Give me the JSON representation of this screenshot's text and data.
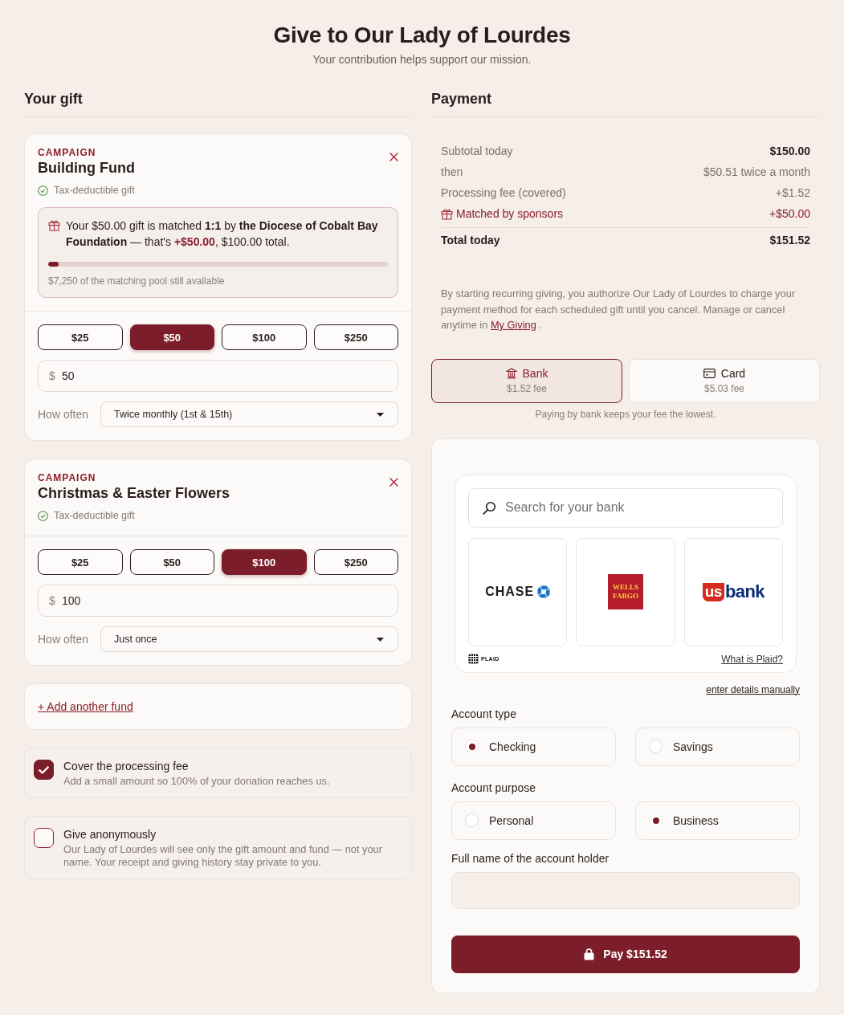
{
  "header": {
    "title": "Give to Our Lady of Lourdes",
    "subtitle": "Your contribution helps support our mission."
  },
  "gift": {
    "heading": "Your gift",
    "funds": [
      {
        "eyebrow": "CAMPAIGN",
        "name": "Building Fund",
        "tax_note": "Tax-deductible gift",
        "match": {
          "message": [
            {
              "text": "Your $50.00 gift is matched ",
              "kind": "plain"
            },
            {
              "text": "1:1",
              "kind": "bold"
            },
            {
              "text": " by ",
              "kind": "plain"
            },
            {
              "text": "the Diocese of Cobalt Bay Foundation",
              "kind": "bold"
            },
            {
              "text": " — that's ",
              "kind": "plain"
            },
            {
              "text": "+$50.00",
              "kind": "amount"
            },
            {
              "text": ", $100.00 total.",
              "kind": "plain"
            }
          ],
          "level": 0.03,
          "pool_note": "$7,250 of the matching pool still available"
        },
        "presets": [
          {
            "label": "$25",
            "selected": false
          },
          {
            "label": "$50",
            "selected": true
          },
          {
            "label": "$100",
            "selected": false
          },
          {
            "label": "$250",
            "selected": false
          }
        ],
        "amount": {
          "currency": "$",
          "value": "50"
        },
        "frequency": {
          "label": "How often",
          "value": "Twice monthly (1st & 15th)"
        }
      },
      {
        "eyebrow": "CAMPAIGN",
        "name": "Christmas & Easter Flowers",
        "tax_note": "Tax-deductible gift",
        "presets": [
          {
            "label": "$25",
            "selected": false
          },
          {
            "label": "$50",
            "selected": false
          },
          {
            "label": "$100",
            "selected": true
          },
          {
            "label": "$250",
            "selected": false
          }
        ],
        "amount": {
          "currency": "$",
          "value": "100"
        },
        "frequency": {
          "label": "How often",
          "value": "Just once"
        }
      }
    ],
    "add_fund_link": "+ Add another fund",
    "options": [
      {
        "title": "Cover the processing fee",
        "description": "Add a small amount so 100% of your donation reaches us.",
        "checked": true
      },
      {
        "title": "Give anonymously",
        "description": "Our Lady of Lourdes will see only the gift amount and fund — not your name. Your receipt and giving history stay private to you.",
        "checked": false
      }
    ]
  },
  "payment": {
    "heading": "Payment",
    "summary": [
      {
        "label": "Subtotal today",
        "value": "$150.00",
        "kind": "subtotal"
      },
      {
        "label": "then",
        "value": "$50.51 twice a month",
        "kind": "plain"
      },
      {
        "label": "Processing fee (covered)",
        "value": "+$1.52",
        "kind": "plain"
      },
      {
        "label": "Matched by sponsors",
        "value": "+$50.00",
        "kind": "match"
      },
      {
        "label": "Total today",
        "value": "$151.52",
        "kind": "total"
      }
    ],
    "authorization": [
      {
        "text": "By starting recurring giving, you authorize Our Lady of Lourdes to charge your payment method for each scheduled gift until you cancel. Manage or cancel anytime in ",
        "kind": "plain"
      },
      {
        "text": "My Giving",
        "kind": "link"
      },
      {
        "text": ".",
        "kind": "plain"
      }
    ],
    "methods": [
      {
        "kind": "bank",
        "label": "Bank",
        "fee": "$1.52 fee",
        "selected": true
      },
      {
        "kind": "card",
        "label": "Card",
        "fee": "$5.03 fee",
        "selected": false
      }
    ],
    "method_note": "Paying by bank keeps your fee the lowest.",
    "bank_link": {
      "search_placeholder": "Search for your bank",
      "banks": [
        {
          "kind": "chase",
          "name": "CHASE"
        },
        {
          "kind": "wells_fargo",
          "name": "WELLS FARGO"
        },
        {
          "kind": "usbank",
          "mark": "us",
          "name": "bank"
        }
      ],
      "provider": "PLAID",
      "help_link": "What is Plaid?"
    },
    "manual_link": "enter details manually",
    "account_type": {
      "label": "Account type",
      "options": [
        {
          "label": "Checking",
          "selected": true
        },
        {
          "label": "Savings",
          "selected": false
        }
      ]
    },
    "account_purpose": {
      "label": "Account purpose",
      "options": [
        {
          "label": "Personal",
          "selected": false
        },
        {
          "label": "Business",
          "selected": true
        }
      ]
    },
    "holder_name": {
      "label": "Full name of the account holder"
    },
    "pay_button": "Pay $151.52"
  }
}
